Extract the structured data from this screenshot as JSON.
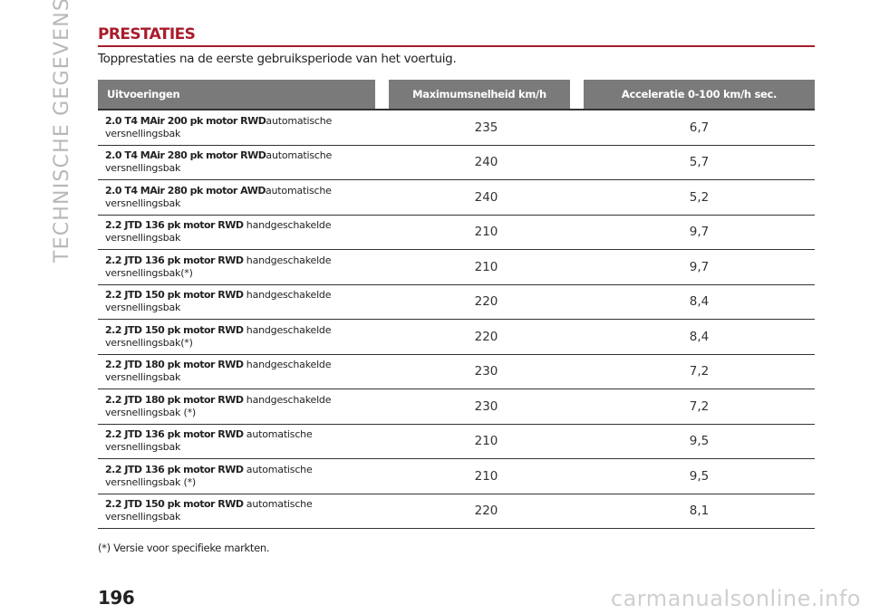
{
  "side_title": "TECHNISCHE GEGEVENS",
  "section_title": "PRESTATIES",
  "subtitle": "Topprestaties na de eerste gebruiksperiode van het voertuig.",
  "table": {
    "headers": [
      "Uitvoeringen",
      "Maximumsnelheid km/h",
      "Acceleratie 0-100 km/h sec."
    ],
    "rows": [
      {
        "model": "2.0 T4 MAir 200 pk motor RWD",
        "trans_line1": "automatische",
        "trans_line2": "versnellingsbak",
        "speed": "235",
        "accel": "6,7"
      },
      {
        "model": "2.0 T4 MAir 280 pk motor RWD",
        "trans_line1": "automatische",
        "trans_line2": "versnellingsbak",
        "speed": "240",
        "accel": "5,7"
      },
      {
        "model": "2.0 T4 MAir 280 pk motor AWD",
        "trans_line1": "automatische",
        "trans_line2": "versnellingsbak",
        "speed": "240",
        "accel": "5,2"
      },
      {
        "model": "2.2 JTD 136 pk motor RWD",
        "trans_line1": " handgeschakelde",
        "trans_line2": "versnellingsbak",
        "speed": "210",
        "accel": "9,7"
      },
      {
        "model": "2.2 JTD 136 pk motor RWD",
        "trans_line1": " handgeschakelde",
        "trans_line2": "versnellingsbak(*)",
        "speed": "210",
        "accel": "9,7"
      },
      {
        "model": "2.2 JTD 150 pk motor RWD",
        "trans_line1": " handgeschakelde",
        "trans_line2": "versnellingsbak",
        "speed": "220",
        "accel": "8,4"
      },
      {
        "model": "2.2 JTD 150 pk motor RWD",
        "trans_line1": " handgeschakelde",
        "trans_line2": "versnellingsbak(*)",
        "speed": "220",
        "accel": "8,4"
      },
      {
        "model": "2.2 JTD 180 pk motor RWD",
        "trans_line1": " handgeschakelde",
        "trans_line2": "versnellingsbak",
        "speed": "230",
        "accel": "7,2"
      },
      {
        "model": "2.2 JTD 180 pk motor RWD",
        "trans_line1": " handgeschakelde",
        "trans_line2": "versnellingsbak (*)",
        "speed": "230",
        "accel": "7,2"
      },
      {
        "model": "2.2 JTD 136 pk motor RWD",
        "trans_line1": " automatische",
        "trans_line2": "versnellingsbak",
        "speed": "210",
        "accel": "9,5"
      },
      {
        "model": "2.2 JTD 136 pk motor RWD",
        "trans_line1": " automatische",
        "trans_line2": "versnellingsbak (*)",
        "speed": "210",
        "accel": "9,5"
      },
      {
        "model": "2.2 JTD 150 pk motor RWD",
        "trans_line1": " automatische",
        "trans_line2": "versnellingsbak",
        "speed": "220",
        "accel": "8,1"
      }
    ]
  },
  "footnote": "(*) Versie voor specifieke markten.",
  "page_number": "196",
  "watermark": "carmanualsonline.info",
  "colors": {
    "accent": "#a81c2c",
    "header_bg": "#7a7a7a",
    "side_title": "#b8b8b8"
  }
}
